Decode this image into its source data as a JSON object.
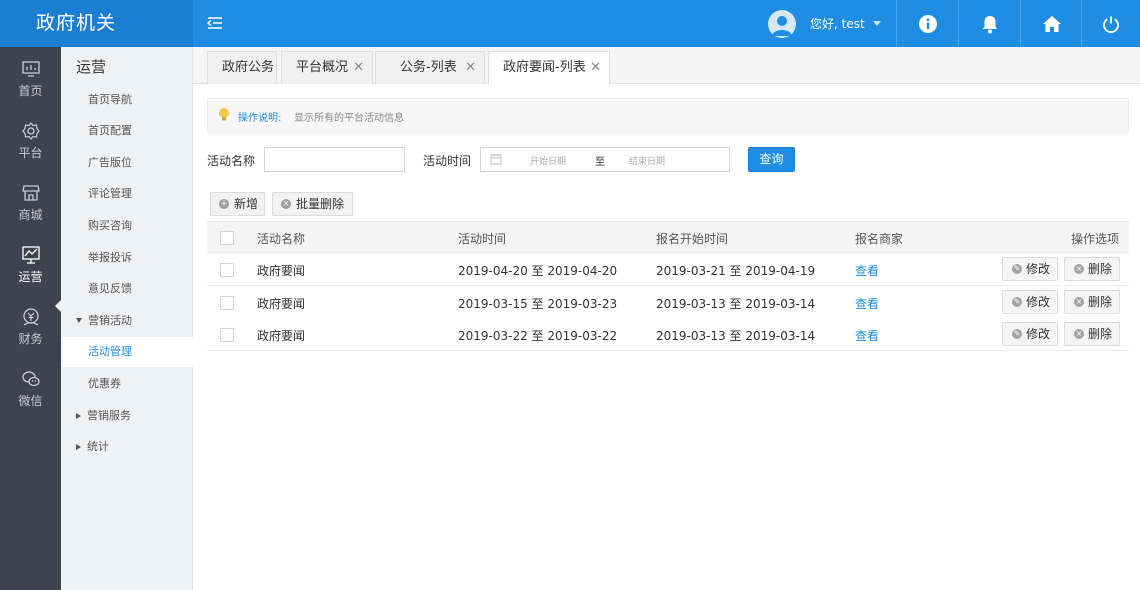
{
  "app": {
    "title": "政府机关"
  },
  "header": {
    "greeting": "您好, test"
  },
  "rail": [
    {
      "label": "首页",
      "icon": "monitor-icon"
    },
    {
      "label": "平台",
      "icon": "gear-icon"
    },
    {
      "label": "商城",
      "icon": "store-icon"
    },
    {
      "label": "运营",
      "icon": "operations-icon"
    },
    {
      "label": "财务",
      "icon": "finance-icon"
    },
    {
      "label": "微信",
      "icon": "wechat-icon"
    }
  ],
  "submenu": {
    "title": "运营",
    "items": [
      "首页导航",
      "首页配置",
      "广告版位",
      "评论管理",
      "购买咨询",
      "举报投诉",
      "意见反馈",
      "营销活动",
      "活动管理",
      "优惠券",
      "营销服务",
      "统计"
    ]
  },
  "tabs": [
    "政府公务",
    "平台概况",
    "公务-列表",
    "政府要闻-列表"
  ],
  "tip": {
    "label": "操作说明:",
    "text": "显示所有的平台活动信息"
  },
  "filter": {
    "name_label": "活动名称",
    "time_label": "活动时间",
    "start_placeholder": "开始日期",
    "to": "至",
    "end_placeholder": "结束日期",
    "query": "查询"
  },
  "toolbar": {
    "add": "新增",
    "batch_delete": "批量删除"
  },
  "table": {
    "columns": [
      "活动名称",
      "活动时间",
      "报名开始时间",
      "报名商家",
      "操作选项"
    ],
    "rows": [
      {
        "name": "政府要闻",
        "time": "2019-04-20 至 2019-04-20",
        "signup": "2019-03-21 至 2019-04-19",
        "merchant": "查看"
      },
      {
        "name": "政府要闻",
        "time": "2019-03-15 至 2019-03-23",
        "signup": "2019-03-13 至 2019-03-14",
        "merchant": "查看"
      },
      {
        "name": "政府要闻",
        "time": "2019-03-22 至 2019-03-22",
        "signup": "2019-03-13 至 2019-03-14",
        "merchant": "查看"
      }
    ],
    "edit": "修改",
    "delete": "删除"
  },
  "colors": {
    "primary": "#1e8de2",
    "rail_bg": "#3d4450",
    "submenu_bg": "#f0f1f3"
  }
}
